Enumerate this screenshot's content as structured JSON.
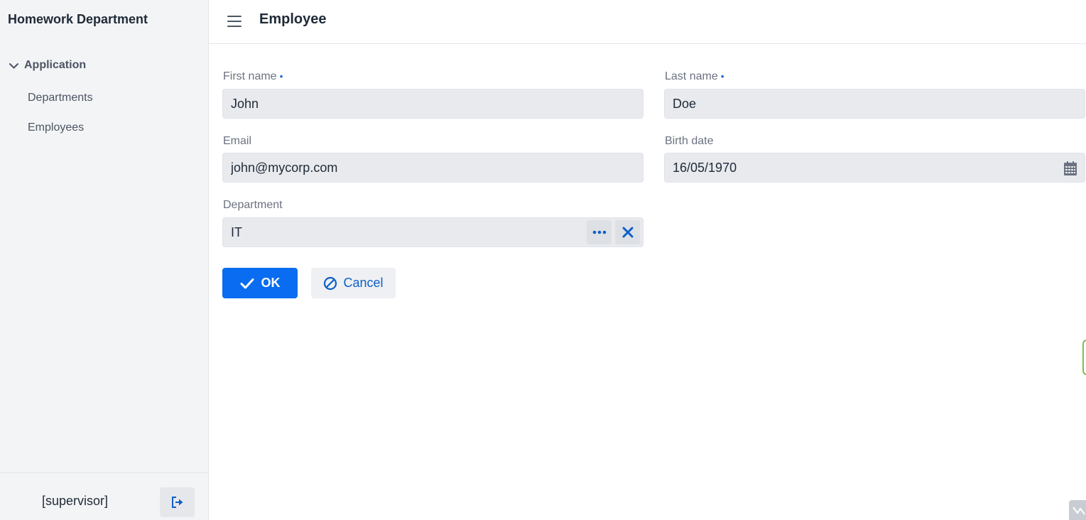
{
  "sidebar": {
    "brand": "Homework Department",
    "group_label": "Application",
    "items": [
      {
        "label": "Departments"
      },
      {
        "label": "Employees"
      }
    ],
    "user_label": "[supervisor]"
  },
  "header": {
    "title": "Employee"
  },
  "form": {
    "first_name": {
      "label": "First name",
      "value": "John",
      "required_mark": "•"
    },
    "last_name": {
      "label": "Last name",
      "value": "Doe",
      "required_mark": "•"
    },
    "email": {
      "label": "Email",
      "value": "john@mycorp.com"
    },
    "birth_date": {
      "label": "Birth date",
      "value": "16/05/1970"
    },
    "department": {
      "label": "Department",
      "value": "IT"
    }
  },
  "actions": {
    "ok_label": "OK",
    "cancel_label": "Cancel"
  },
  "colors": {
    "primary": "#0a6cf0",
    "required_dot": "#1e6fd9"
  },
  "icons": {
    "header_menu": "hamburger-icon",
    "group_toggle": "chevron-down-icon",
    "logout": "logout-icon",
    "calendar": "calendar-icon",
    "lookup": "more-horizontal-icon",
    "clear": "close-icon",
    "ok": "check-icon",
    "cancel": "ban-icon"
  }
}
